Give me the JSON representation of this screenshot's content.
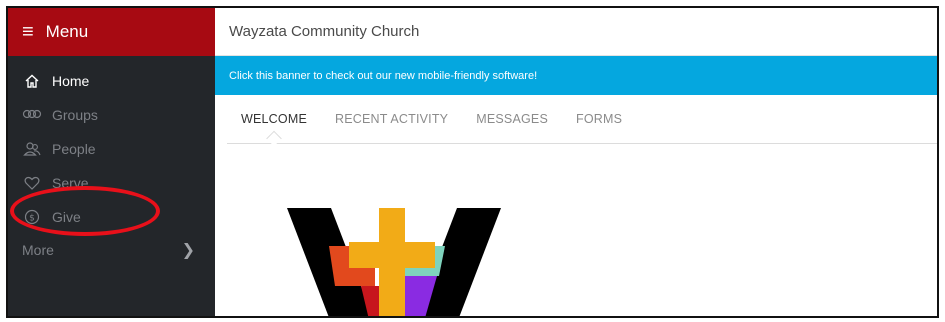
{
  "sidebar": {
    "menu_label": "Menu",
    "items": [
      {
        "label": "Home",
        "icon": "home-icon",
        "active": true
      },
      {
        "label": "Groups",
        "icon": "groups-icon",
        "active": false
      },
      {
        "label": "People",
        "icon": "people-icon",
        "active": false
      },
      {
        "label": "Serve",
        "icon": "heart-icon",
        "active": false
      },
      {
        "label": "Give",
        "icon": "dollar-icon",
        "active": false
      }
    ],
    "more_label": "More"
  },
  "header": {
    "title": "Wayzata Community Church"
  },
  "banner": {
    "text": "Click this banner to check out our new mobile-friendly software!"
  },
  "tabs": [
    {
      "label": "WELCOME",
      "active": true
    },
    {
      "label": "RECENT ACTIVITY",
      "active": false
    },
    {
      "label": "MESSAGES",
      "active": false
    },
    {
      "label": "FORMS",
      "active": false
    }
  ],
  "colors": {
    "menu_header": "#a70a12",
    "sidebar_bg": "#23262a",
    "banner_bg": "#05a7df",
    "annotation": "#e8101a"
  }
}
